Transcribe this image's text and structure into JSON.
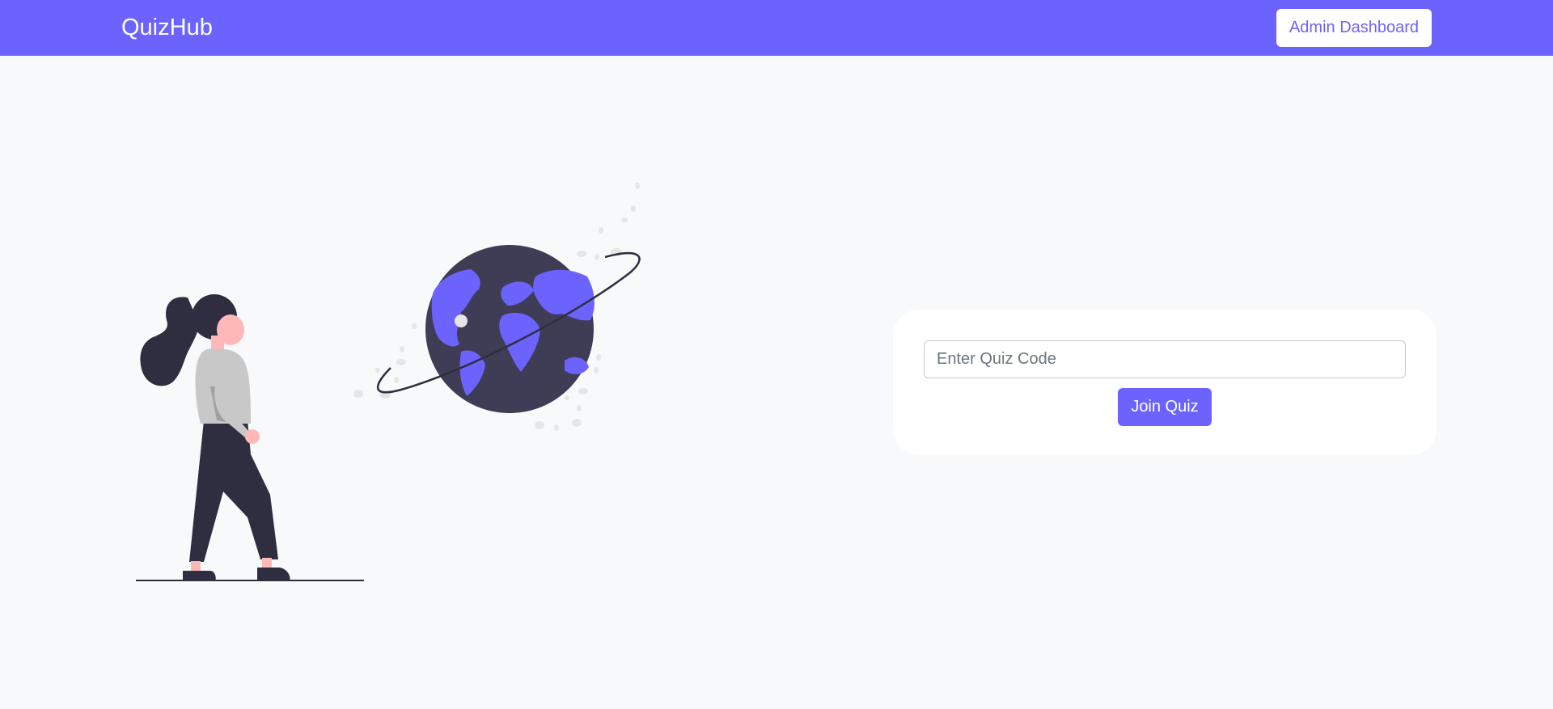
{
  "navbar": {
    "brand": "QuizHub",
    "admin_button_label": "Admin Dashboard"
  },
  "hero": {
    "illustration": "woman-looking-at-globe-illustration"
  },
  "join_card": {
    "code_placeholder": "Enter Quiz Code",
    "code_value": "",
    "join_button_label": "Join Quiz"
  },
  "colors": {
    "accent": "#6c63ff",
    "dark": "#3f3d56",
    "ink": "#2f2e41",
    "background": "#f8f9fa"
  }
}
